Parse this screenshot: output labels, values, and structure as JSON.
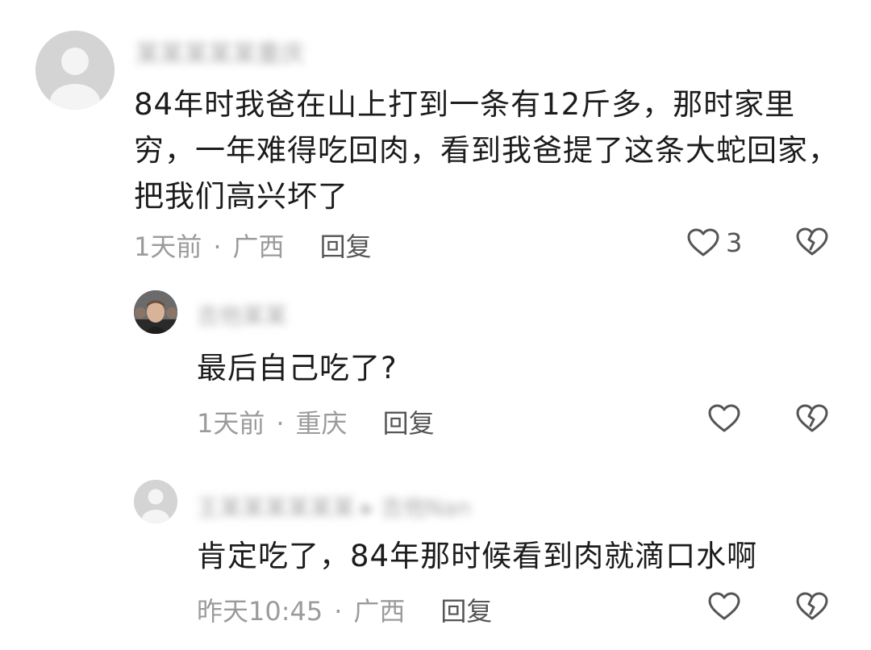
{
  "comments": [
    {
      "author": "某某某某某重庆",
      "text": "84年时我爸在山上打到一条有12斤多，那时家里穷，一年难得吃回肉，看到我爸提了这条大蛇回家，把我们高兴坏了",
      "time": "1天前",
      "location": "广西",
      "reply_label": "回复",
      "likes": "3",
      "avatar": "default-avatar-icon"
    },
    {
      "author": "吉他某某",
      "text": "最后自己吃了?",
      "time": "1天前",
      "location": "重庆",
      "reply_label": "回复",
      "likes": "",
      "avatar": "user-photo"
    },
    {
      "author": "王某某某某某某 ▸ 吉他Nan",
      "text": "肯定吃了，84年那时候看到肉就滴口水啊",
      "time": "昨天10:45",
      "location": "广西",
      "reply_label": "回复",
      "likes": "",
      "avatar": "default-avatar-icon"
    }
  ],
  "separator": "·",
  "colors": {
    "text": "#1c1c1c",
    "meta": "#9b9b9b",
    "icon": "#555555"
  }
}
